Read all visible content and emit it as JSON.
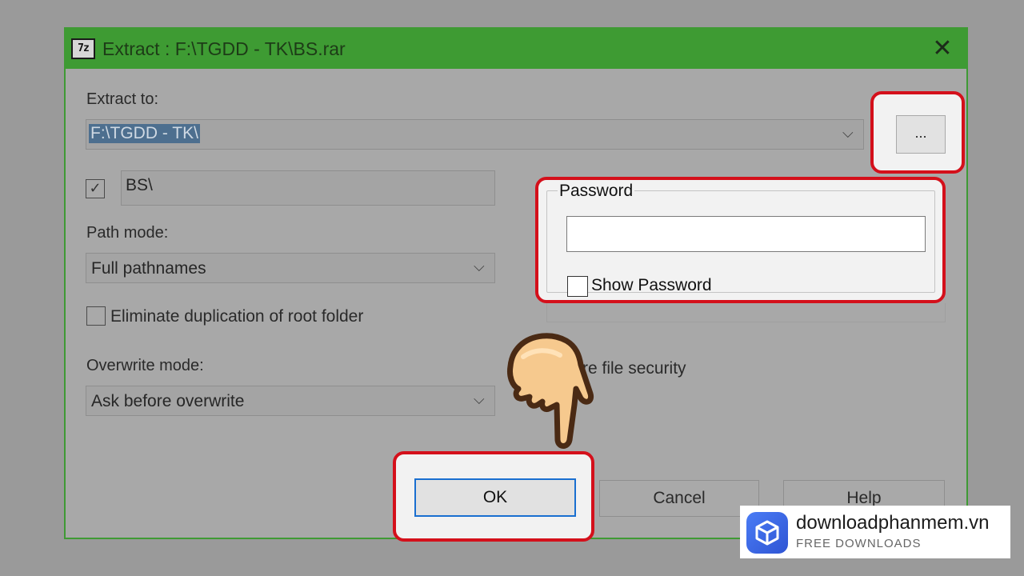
{
  "window": {
    "icon_text": "7z",
    "title": "Extract : F:\\TGDD - TK\\BS.rar",
    "close_glyph": "✕"
  },
  "extract_to": {
    "label": "Extract to:",
    "value": "F:\\TGDD - TK\\",
    "browse_label": "..."
  },
  "subfolder": {
    "checked": true,
    "check_glyph": "✓",
    "value": "BS\\"
  },
  "path_mode": {
    "label": "Path mode:",
    "value": "Full pathnames"
  },
  "eliminate_duplication": {
    "label": "Eliminate duplication of root folder",
    "checked": false
  },
  "overwrite_mode": {
    "label": "Overwrite mode:",
    "value": "Ask before overwrite"
  },
  "restore_security": {
    "label": "Restore file security",
    "visible_label": "store file security"
  },
  "password": {
    "group_label": "Password",
    "value": "",
    "show_label": "Show Password",
    "show_checked": false
  },
  "buttons": {
    "ok": "OK",
    "cancel": "Cancel",
    "help": "Help"
  },
  "chevron_glyph": "⌵",
  "highlight_color": "#d4101b",
  "title_bar_color": "#3e9b33",
  "watermark": {
    "name": "downloadphanmem.vn",
    "tagline": "FREE DOWNLOADS"
  }
}
